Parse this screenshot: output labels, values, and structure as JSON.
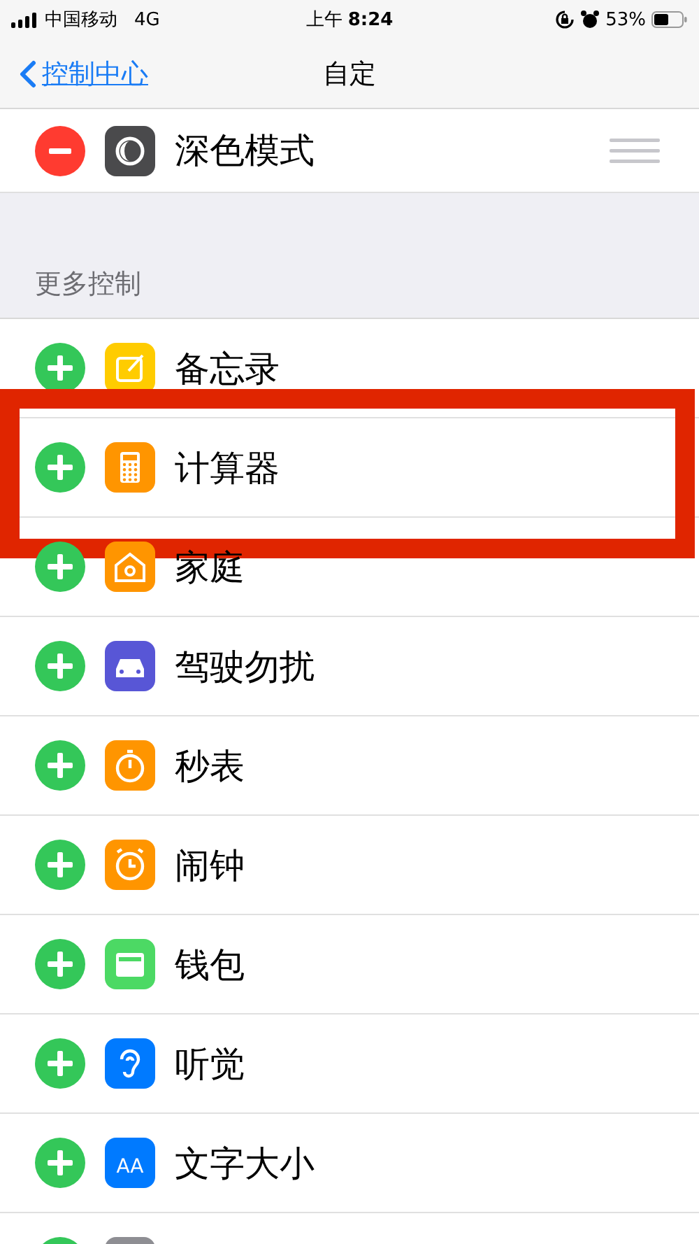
{
  "status_bar": {
    "carrier": "中国移动",
    "network": "4G",
    "time_prefix": "上午",
    "time": "8:24",
    "battery": "53%"
  },
  "nav": {
    "back": "控制中心",
    "title": "自定"
  },
  "included": [
    {
      "label": "深色模式",
      "kind": "contrast",
      "color": "#4a4a4c"
    }
  ],
  "more_header": "更多控制",
  "more": [
    {
      "label": "备忘录",
      "kind": "notes",
      "color": "#ffcc00",
      "highlighted": false
    },
    {
      "label": "计算器",
      "kind": "calculator",
      "color": "#ff9500",
      "highlighted": true
    },
    {
      "label": "家庭",
      "kind": "home",
      "color": "#ff9500",
      "highlighted": false
    },
    {
      "label": "驾驶勿扰",
      "kind": "car",
      "color": "#5856d6",
      "highlighted": false
    },
    {
      "label": "秒表",
      "kind": "stopwatch",
      "color": "#ff9500",
      "highlighted": false
    },
    {
      "label": "闹钟",
      "kind": "alarm",
      "color": "#ff9500",
      "highlighted": false
    },
    {
      "label": "钱包",
      "kind": "wallet",
      "color": "#4cd964",
      "highlighted": false
    },
    {
      "label": "听觉",
      "kind": "ear",
      "color": "#007aff",
      "highlighted": false
    },
    {
      "label": "文字大小",
      "kind": "textsize",
      "color": "#007aff",
      "glyph": "AA",
      "highlighted": false
    },
    {
      "kind": "blank",
      "color": "#8e8e93",
      "highlighted": false
    }
  ]
}
